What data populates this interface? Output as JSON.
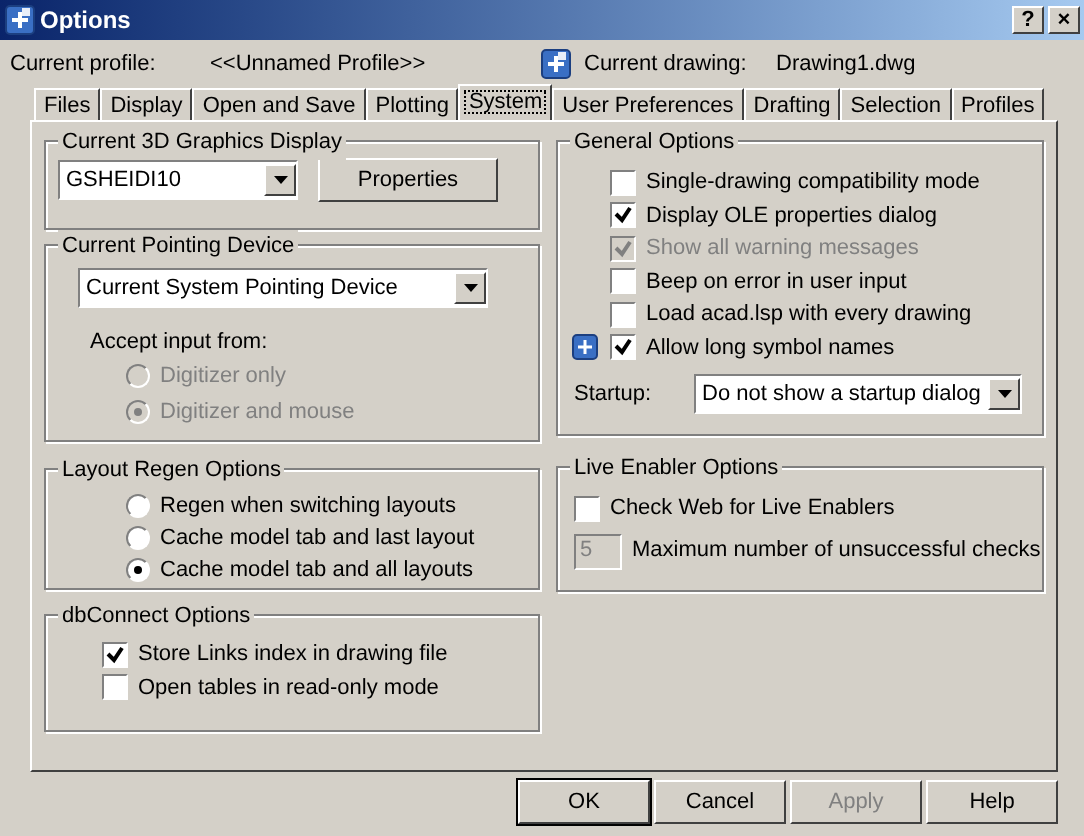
{
  "window": {
    "title": "Options",
    "buttons": [
      "?",
      "×"
    ]
  },
  "profile": {
    "label": "Current profile:",
    "value": "<<Unnamed Profile>>"
  },
  "drawing": {
    "label": "Current drawing:",
    "value": "Drawing1.dwg"
  },
  "tabs": [
    {
      "label": "Files",
      "selected": false
    },
    {
      "label": "Display",
      "selected": false
    },
    {
      "label": "Open and Save",
      "selected": false
    },
    {
      "label": "Plotting",
      "selected": false
    },
    {
      "label": "System",
      "selected": true
    },
    {
      "label": "User Preferences",
      "selected": false
    },
    {
      "label": "Drafting",
      "selected": false
    },
    {
      "label": "Selection",
      "selected": false
    },
    {
      "label": "Profiles",
      "selected": false
    }
  ],
  "left_groups": [
    {
      "title": "Current 3D Graphics Display",
      "items": [
        {
          "kind": "combo",
          "value": "GSHEIDI10",
          "button": "Properties"
        }
      ]
    },
    {
      "title": "Current Pointing Device",
      "items": [
        {
          "kind": "combo",
          "value": "Current System Pointing Device"
        },
        {
          "kind": "label",
          "text": "Accept input from:"
        },
        {
          "kind": "radio",
          "label": "Digitizer only",
          "selected": false,
          "disabled": true
        },
        {
          "kind": "radio",
          "label": "Digitizer and mouse",
          "selected": true,
          "disabled": true
        }
      ]
    },
    {
      "title": "Layout Regen Options",
      "items": [
        {
          "kind": "radio",
          "label": "Regen when switching layouts",
          "selected": false,
          "disabled": false
        },
        {
          "kind": "radio",
          "label": "Cache model tab and last layout",
          "selected": false,
          "disabled": false
        },
        {
          "kind": "radio",
          "label": "Cache model tab and all layouts",
          "selected": true,
          "disabled": false
        }
      ]
    },
    {
      "title": "dbConnect Options",
      "items": [
        {
          "kind": "checkbox",
          "label": "Store Links index in drawing file",
          "checked": true,
          "disabled": false,
          "stored_in_drawing": false
        },
        {
          "kind": "checkbox",
          "label": "Open tables in read-only mode",
          "checked": false,
          "disabled": false,
          "stored_in_drawing": false
        }
      ]
    }
  ],
  "right_groups": [
    {
      "title": "General Options",
      "items": [
        {
          "kind": "checkbox",
          "label": "Single-drawing compatibility mode",
          "checked": false,
          "disabled": false,
          "stored_in_drawing": false
        },
        {
          "kind": "checkbox",
          "label": "Display OLE properties dialog",
          "checked": true,
          "disabled": false,
          "stored_in_drawing": false
        },
        {
          "kind": "checkbox",
          "label": "Show all warning messages",
          "checked": true,
          "disabled": true,
          "stored_in_drawing": false
        },
        {
          "kind": "checkbox",
          "label": "Beep on error in user input",
          "checked": false,
          "disabled": false,
          "stored_in_drawing": false
        },
        {
          "kind": "checkbox",
          "label": "Load acad.lsp with every drawing",
          "checked": false,
          "disabled": false,
          "stored_in_drawing": false
        },
        {
          "kind": "checkbox",
          "label": "Allow long symbol names",
          "checked": true,
          "disabled": false,
          "stored_in_drawing": true
        },
        {
          "kind": "select",
          "label": "Startup:",
          "value": "Do not show a startup dialog"
        }
      ]
    },
    {
      "title": "Live Enabler Options",
      "items": [
        {
          "kind": "checkbox",
          "label": "Check Web for Live Enablers",
          "checked": false,
          "disabled": false,
          "stored_in_drawing": false
        },
        {
          "kind": "number",
          "value": "5",
          "label": "Maximum number of unsuccessful checks",
          "disabled": true
        }
      ]
    }
  ],
  "buttons": [
    {
      "label": "OK",
      "default": true,
      "disabled": false
    },
    {
      "label": "Cancel",
      "default": false,
      "disabled": false
    },
    {
      "label": "Apply",
      "default": false,
      "disabled": true
    },
    {
      "label": "Help",
      "default": false,
      "disabled": false
    }
  ]
}
